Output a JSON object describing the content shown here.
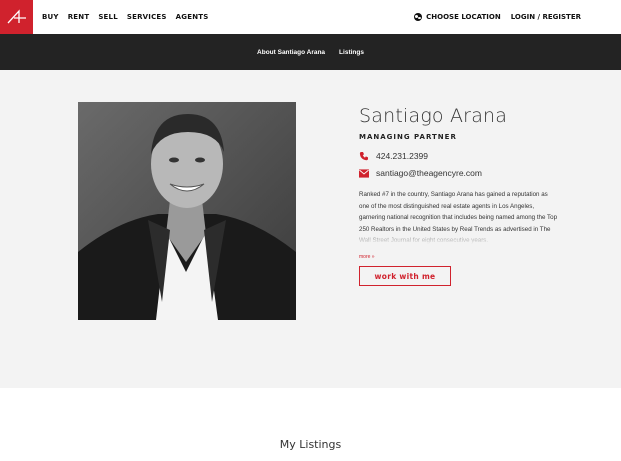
{
  "nav": {
    "logo_icon": "agency-logo-icon",
    "items": [
      "BUY",
      "RENT",
      "SELL",
      "SERVICES",
      "AGENTS"
    ],
    "choose_location": "CHOOSE LOCATION",
    "login": "LOGIN / REGISTER"
  },
  "subnav": {
    "tabs": [
      "About Santiago Arana",
      "Listings"
    ]
  },
  "agent": {
    "name": "Santiago Arana",
    "title": "MANAGING PARTNER",
    "phone": "424.231.2399",
    "email": "santiago@theagencyre.com",
    "bio": "Ranked #7 in the country, Santiago Arana has gained a reputation as one of the most distinguished real estate agents in Los Angeles, garnering national recognition that includes being named among the Top 250 Realtors in the United States by Real Trends as advertised in The Wall Street Journal for eight consecutive years.",
    "more_link": "more »",
    "cta": "work with me"
  },
  "listings": {
    "heading": "My Listings"
  },
  "colors": {
    "accent": "#d0222d",
    "subnav_bg": "#232323",
    "profile_bg": "#f3f3f3"
  }
}
